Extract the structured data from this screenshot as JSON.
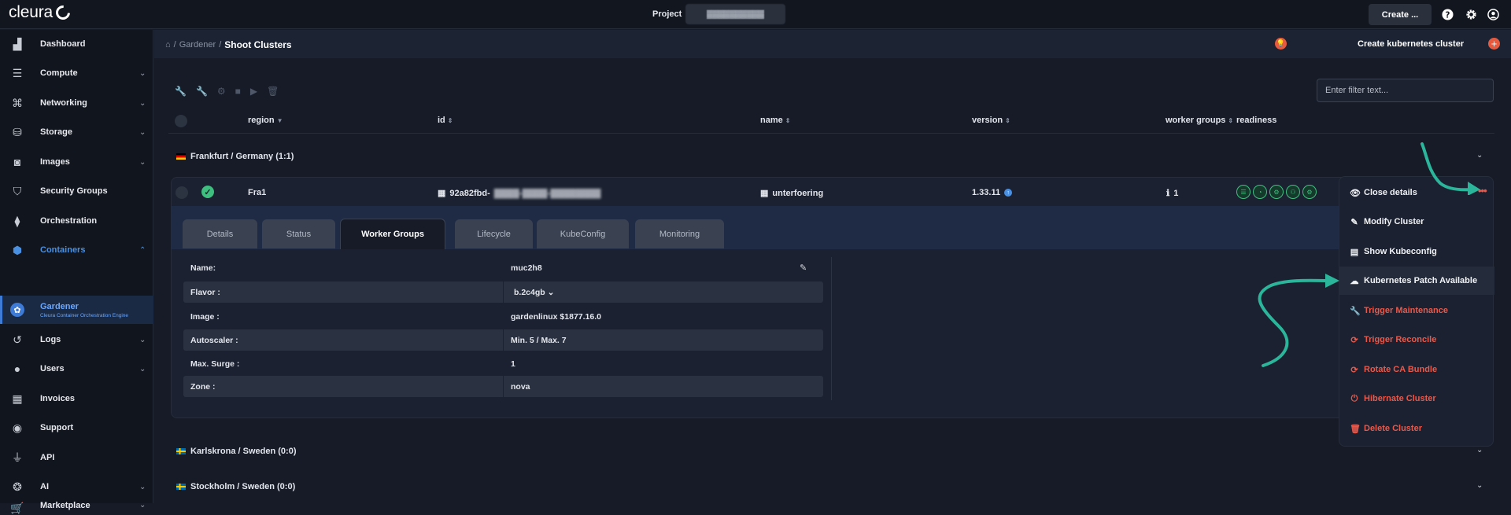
{
  "topbar": {
    "logo_text": "cleura",
    "project_label": "Project",
    "project_value": "▓▓▓▓▓▓▓▓▓▓",
    "create_label": "Create ...",
    "icons": [
      "help-icon",
      "settings-icon",
      "user-icon"
    ]
  },
  "sidebar": {
    "items": [
      {
        "label": "Dashboard",
        "icon": "chart-icon",
        "expandable": false
      },
      {
        "label": "Compute",
        "icon": "server-icon",
        "expandable": true
      },
      {
        "label": "Networking",
        "icon": "network-icon",
        "expandable": true
      },
      {
        "label": "Storage",
        "icon": "database-icon",
        "expandable": true
      },
      {
        "label": "Images",
        "icon": "camera-icon",
        "expandable": true
      },
      {
        "label": "Security Groups",
        "icon": "shield-icon",
        "expandable": false
      },
      {
        "label": "Orchestration",
        "icon": "layers-icon",
        "expandable": false
      },
      {
        "label": "Containers",
        "icon": "cube-icon",
        "expandable": true
      },
      {
        "label": "Logs",
        "icon": "history-icon",
        "expandable": true
      },
      {
        "label": "Users",
        "icon": "user-icon",
        "expandable": true
      },
      {
        "label": "Invoices",
        "icon": "calculator-icon",
        "expandable": false
      },
      {
        "label": "Support",
        "icon": "lifebuoy-icon",
        "expandable": false
      },
      {
        "label": "API",
        "icon": "plug-icon",
        "expandable": false
      },
      {
        "label": "AI",
        "icon": "ai-icon",
        "expandable": true
      },
      {
        "label": "Marketplace",
        "icon": "cart-icon",
        "expandable": true
      }
    ],
    "active_sub": {
      "label": "Gardener",
      "sublabel": "Cleura Container Orchestration Engine"
    }
  },
  "header": {
    "breadcrumb": [
      "Gardener",
      "Shoot Clusters"
    ],
    "create_label": "Create kubernetes cluster"
  },
  "filter": {
    "placeholder": "Enter filter text..."
  },
  "table": {
    "columns": [
      "region",
      "id",
      "name",
      "version",
      "worker groups",
      "readiness"
    ],
    "groups": [
      {
        "label": "Frankfurt / Germany (1:1)"
      },
      {
        "label": "Karlskrona / Sweden (0:0)"
      },
      {
        "label": "Stockholm / Sweden (0:0)"
      }
    ],
    "row": {
      "region": "Fra1",
      "id_prefix": "92a82fbd-",
      "id_blurred": "▓▓▓▓-▓▓▓▓-▓▓▓▓▓▓▓▓",
      "name": "unterfoering",
      "version": "1.33.11",
      "worker_groups": "1"
    }
  },
  "tabs": [
    "Details",
    "Status",
    "Worker Groups",
    "Lifecycle",
    "KubeConfig",
    "Monitoring"
  ],
  "active_tab": "Worker Groups",
  "worker_group": {
    "rows": [
      {
        "key": "Name:",
        "value": "muc2h8"
      },
      {
        "key": "Flavor :",
        "value": "b.2c4gb"
      },
      {
        "key": "Image :",
        "value": "gardenlinux $1877.16.0"
      },
      {
        "key": "Autoscaler :",
        "value": "Min. 5 / Max. 7"
      },
      {
        "key": "Max. Surge :",
        "value": "1"
      },
      {
        "key": "Zone :",
        "value": "nova"
      }
    ]
  },
  "menu": {
    "items": [
      {
        "label": "Close details",
        "icon": "eye-icon"
      },
      {
        "label": "Modify Cluster",
        "icon": "edit-icon"
      },
      {
        "label": "Show Kubeconfig",
        "icon": "file-icon"
      },
      {
        "label": "Kubernetes Patch Available",
        "icon": "cloud-icon"
      },
      {
        "label": "Trigger Maintenance",
        "icon": "wrench-icon"
      },
      {
        "label": "Trigger Reconcile",
        "icon": "sync-icon"
      },
      {
        "label": "Rotate CA Bundle",
        "icon": "rotate-icon"
      },
      {
        "label": "Hibernate Cluster",
        "icon": "power-icon"
      },
      {
        "label": "Delete Cluster",
        "icon": "trash-icon"
      }
    ]
  },
  "colors": {
    "accent": "#4a90e2",
    "danger": "#e9594b",
    "success": "#3fbf7f",
    "annotation": "#2bb59a"
  }
}
